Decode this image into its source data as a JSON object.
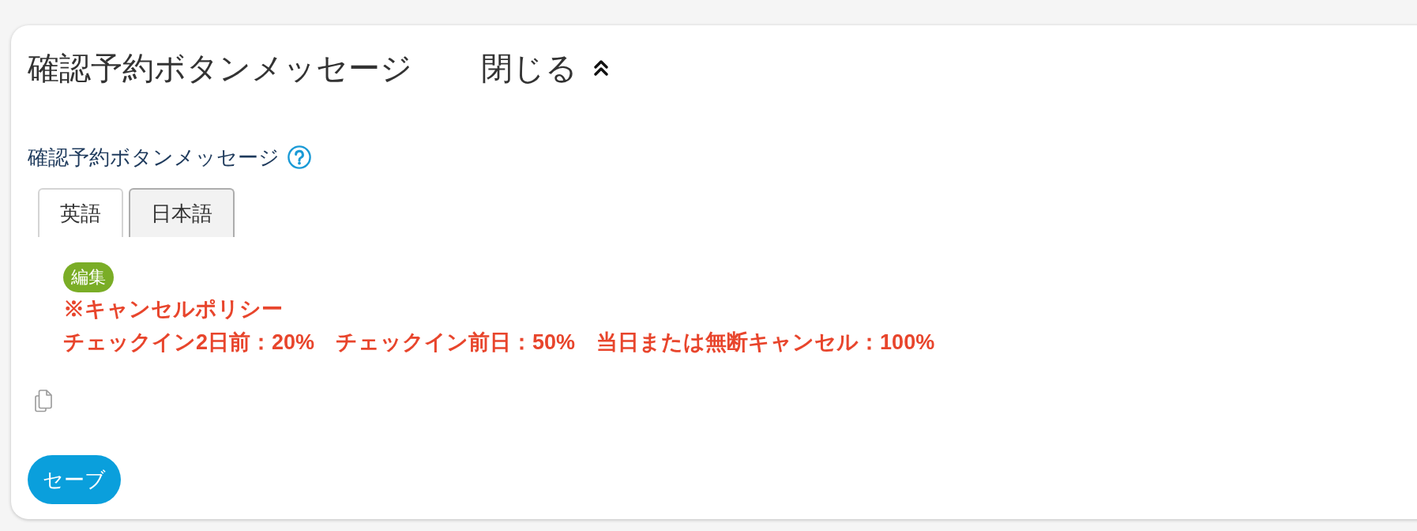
{
  "panel": {
    "title": "確認予約ボタンメッセージ",
    "toggle_label": "閉じる",
    "expanded": true
  },
  "field": {
    "label": "確認予約ボタンメッセージ"
  },
  "tabs": [
    {
      "label": "英語",
      "selected": true
    },
    {
      "label": "日本語",
      "selected": false
    }
  ],
  "editor": {
    "edit_label": "編集",
    "lines": [
      "※キャンセルポリシー",
      "チェックイン2日前：20%　チェックイン前日：50%　当日または無断キャンセル：100%"
    ]
  },
  "save_button": {
    "label": "セーブ"
  }
}
